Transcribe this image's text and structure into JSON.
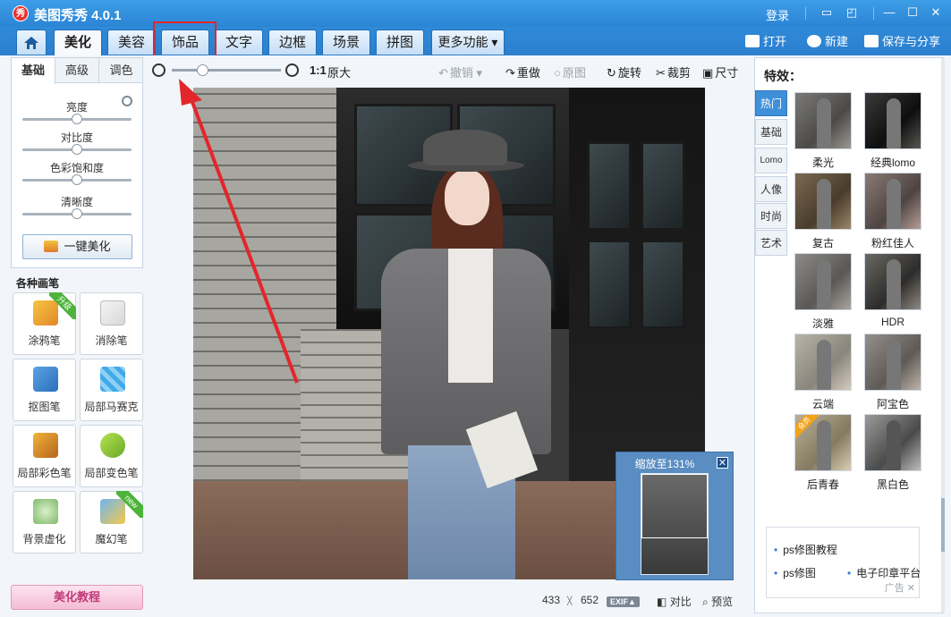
{
  "titlebar": {
    "logo_text": "秀",
    "title": "美图秀秀 4.0.1",
    "login": "登录"
  },
  "tabs": [
    {
      "label": "美化",
      "active": true
    },
    {
      "label": "美容"
    },
    {
      "label": "饰品",
      "highlighted": true
    },
    {
      "label": "文字"
    },
    {
      "label": "边框"
    },
    {
      "label": "场景"
    },
    {
      "label": "拼图"
    },
    {
      "label": "更多功能 ▾"
    }
  ],
  "top_actions": {
    "open": "打开",
    "new": "新建",
    "save": "保存与分享"
  },
  "left": {
    "subtabs": [
      "基础",
      "高级",
      "调色"
    ],
    "sliders": [
      {
        "label": "亮度",
        "value": 0.5
      },
      {
        "label": "对比度",
        "value": 0.5
      },
      {
        "label": "色彩饱和度",
        "value": 0.5
      },
      {
        "label": "清晰度",
        "value": 0.5
      }
    ],
    "onekey": "一键美化",
    "brush_title": "各种画笔",
    "brushes": [
      {
        "label": "涂鸦笔",
        "badge": "升级"
      },
      {
        "label": "消除笔"
      },
      {
        "label": "抠图笔"
      },
      {
        "label": "局部马赛克"
      },
      {
        "label": "局部彩色笔"
      },
      {
        "label": "局部变色笔"
      },
      {
        "label": "背景虚化"
      },
      {
        "label": "魔幻笔",
        "badge": "new"
      }
    ],
    "tutorial": "美化教程"
  },
  "toolbar": {
    "ratio": "1:1",
    "original_size": "原大",
    "undo": "撤销",
    "redo": "重做",
    "original": "原图",
    "rotate": "旋转",
    "crop": "裁剪",
    "size": "尺寸",
    "zoom_level": 0.28
  },
  "zoom_popup": {
    "title": "缩放至131%",
    "close": "✕"
  },
  "status": {
    "width": "433",
    "times": "╳",
    "height": "652",
    "exif": "EXIF▲",
    "compare": "对比",
    "preview": "预览"
  },
  "right": {
    "title": "特效：",
    "categories": [
      "热门",
      "基础",
      "Lomo",
      "人像",
      "时尚",
      "艺术"
    ],
    "effects": [
      {
        "label": "柔光"
      },
      {
        "label": "经典lomo"
      },
      {
        "label": "复古"
      },
      {
        "label": "粉红佳人"
      },
      {
        "label": "淡雅"
      },
      {
        "label": "HDR"
      },
      {
        "label": "云端"
      },
      {
        "label": "阿宝色"
      },
      {
        "label": "后青春",
        "badge": "会员"
      },
      {
        "label": "黑白色"
      }
    ],
    "ad_lines": [
      "ps修图教程",
      "ps修图",
      "电子印章平台"
    ],
    "ad_foot": "广告 ✕",
    "colors": {
      "active_tab": "#3f8fd9"
    }
  },
  "colors": {
    "titlebar": "#2b85d5",
    "highlight": "#e3262b"
  }
}
